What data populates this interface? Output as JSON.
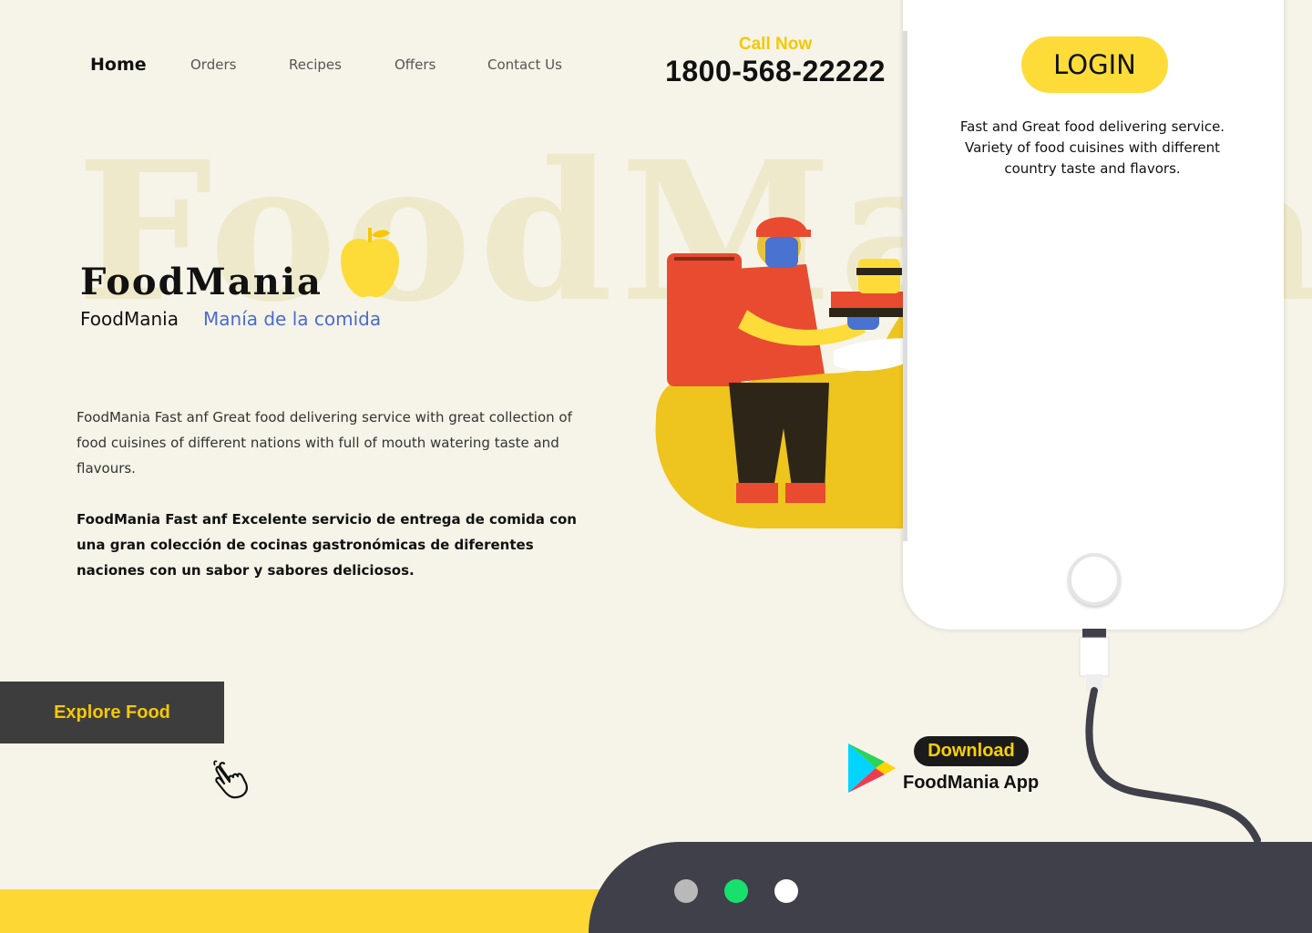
{
  "nav": {
    "items": [
      {
        "label": "Home",
        "active": true
      },
      {
        "label": "Orders"
      },
      {
        "label": "Recipes"
      },
      {
        "label": "Offers"
      },
      {
        "label": "Contact Us"
      }
    ]
  },
  "call": {
    "label": "Call Now",
    "phone": "1800-568-22222"
  },
  "hero": {
    "watermark": "FoodMania",
    "brand": "FoodMania",
    "subtitle_en": "FoodMania",
    "subtitle_es": "Manía de la comida",
    "description_en": "FoodMania Fast anf Great food delivering service with great collection of food cuisines of different nations with full of mouth watering taste and flavours.",
    "description_es": "FoodMania Fast anf Excelente servicio de entrega de comida con una gran colección de cocinas gastronómicas de diferentes naciones con un sabor y sabores deliciosos.",
    "explore_label": "Explore Food"
  },
  "phone": {
    "login_label": "LOGIN",
    "text": "Fast and Great food delivering service. Variety of food cuisines with different country taste and flavors."
  },
  "download": {
    "badge": "Download",
    "app": "FoodMania App"
  },
  "colors": {
    "background": "#f6f4e8",
    "accent_yellow": "#fdd835",
    "dark": "#3f4049",
    "link_blue": "#4a6bd4"
  },
  "slider": {
    "dots": [
      "#b9b9b9",
      "#17e06d",
      "#ffffff"
    ],
    "active_index": 1
  }
}
